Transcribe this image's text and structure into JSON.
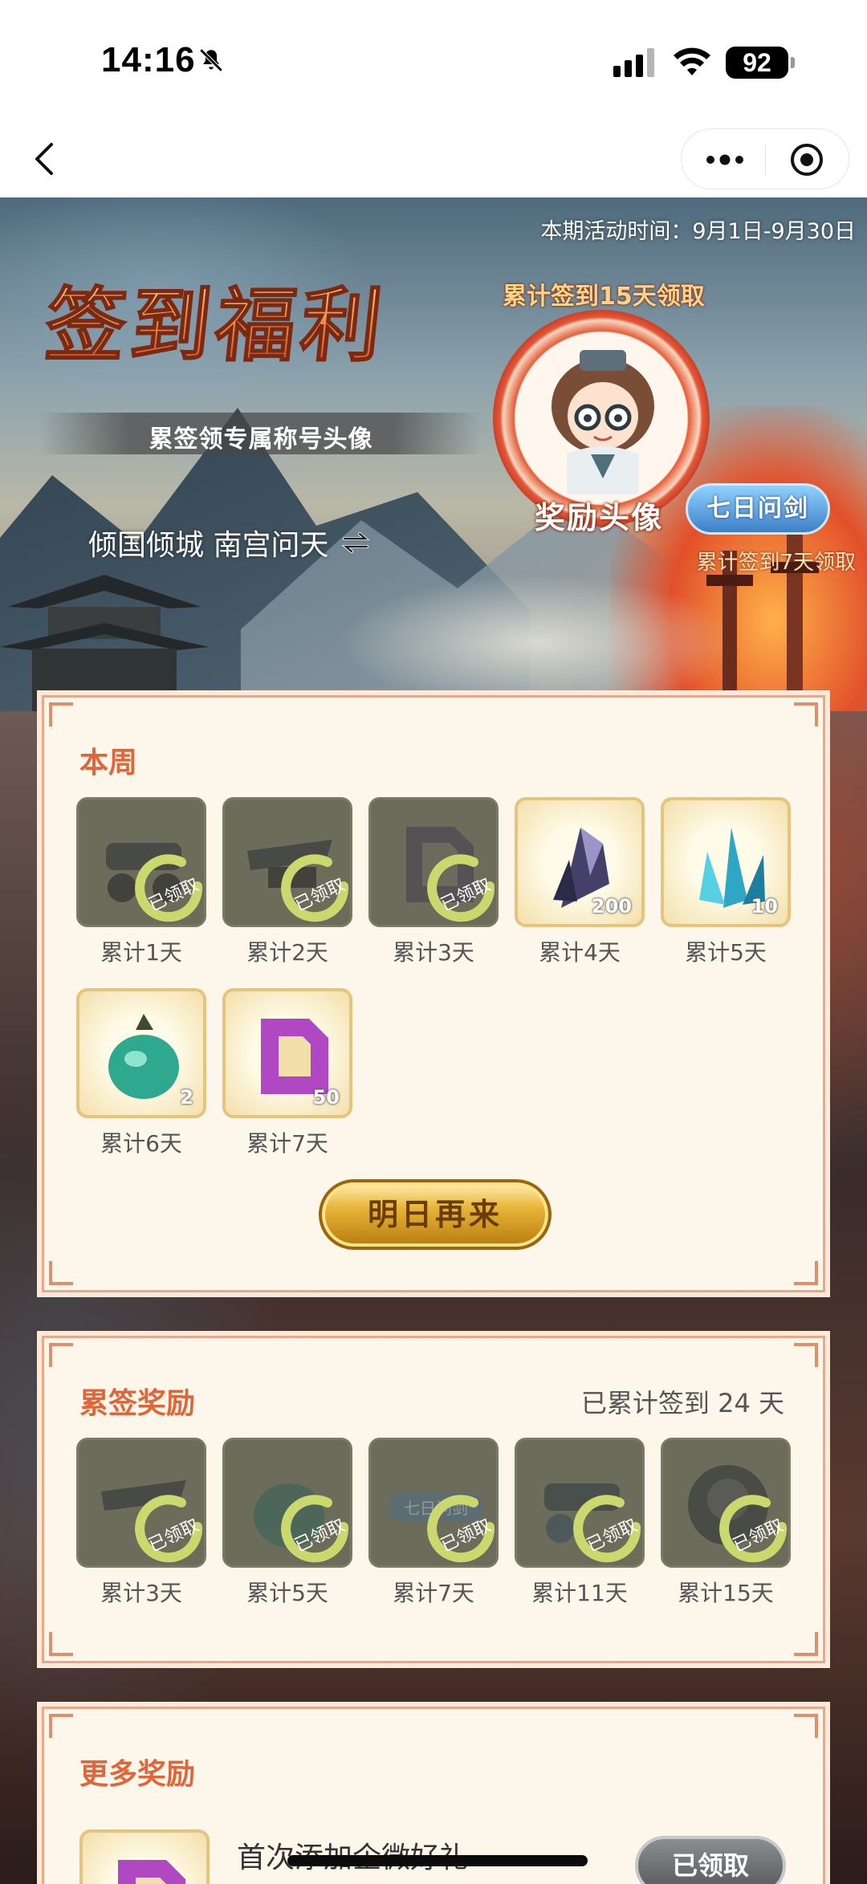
{
  "status_bar": {
    "time": "14:16",
    "battery": "92",
    "icons": [
      "bell-slash-icon",
      "cellular-signal-icon",
      "wifi-icon",
      "battery-icon"
    ]
  },
  "nav_bar": {
    "icons": [
      "back-chevron-icon",
      "more-dots-icon",
      "target-circle-icon"
    ]
  },
  "hero": {
    "activity_time": "本期活动时间：9月1日-9月30日",
    "title": "签到福利",
    "subtitle": "累签领专属称号头像",
    "player_title": "倾国倾城 南宫问天",
    "avatar_top_label": "累计签到15天领取",
    "avatar_caption": "奖励头像",
    "badge_label": "七日问剑",
    "badge_caption": "累计签到7天领取"
  },
  "week_panel": {
    "title": "本周",
    "claimed_stamp": "已领取",
    "items": [
      {
        "label": "累计1天",
        "claimed": true,
        "qty": ""
      },
      {
        "label": "累计2天",
        "claimed": true,
        "qty": ""
      },
      {
        "label": "累计3天",
        "claimed": true,
        "qty": ""
      },
      {
        "label": "累计4天",
        "claimed": false,
        "qty": "200"
      },
      {
        "label": "累计5天",
        "claimed": false,
        "qty": "10"
      },
      {
        "label": "累计6天",
        "claimed": false,
        "qty": "2"
      },
      {
        "label": "累计7天",
        "claimed": false,
        "qty": "50"
      }
    ],
    "button_label": "明日再来"
  },
  "cumulative_panel": {
    "title": "累签奖励",
    "progress_text": "已累计签到 24 天",
    "items": [
      {
        "label": "累计3天",
        "claimed": true
      },
      {
        "label": "累计5天",
        "claimed": true
      },
      {
        "label": "累计7天",
        "claimed": true,
        "tile_text": "七日问剑"
      },
      {
        "label": "累计11天",
        "claimed": true
      },
      {
        "label": "累计15天",
        "claimed": true
      }
    ]
  },
  "more_panel": {
    "title": "更多奖励",
    "first_item": {
      "text": "首次添加企微好礼",
      "button_label": "已领取"
    }
  },
  "colors": {
    "accent": "#e0663a",
    "panel_bg": "#fdf6ea",
    "panel_border": "#e8a88a",
    "gold_button": "#e8b438"
  }
}
